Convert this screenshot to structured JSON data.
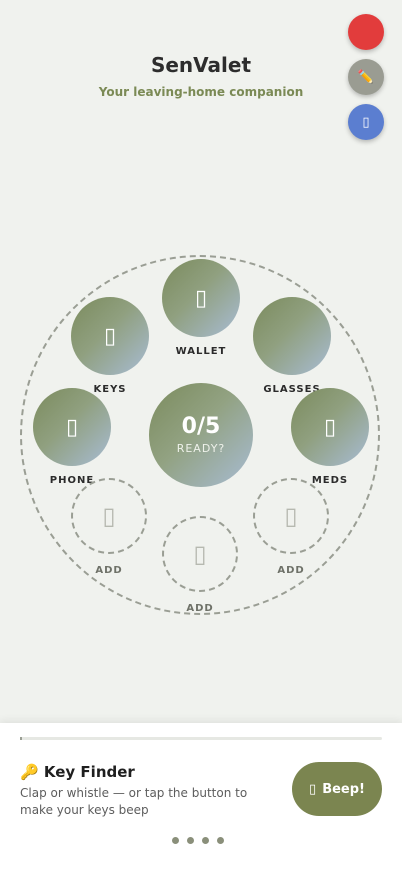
{
  "header": {
    "title": "SenValet",
    "subtitle": "Your leaving-home companion"
  },
  "fabs": [
    {
      "name": "record",
      "color": "#e23c3c",
      "icon": "record-icon",
      "glyph": ""
    },
    {
      "name": "edit",
      "color": "#9a9c92",
      "icon": "pencil-icon",
      "glyph": "✏️"
    },
    {
      "name": "info",
      "color": "#5b7ed0",
      "icon": "info-icon",
      "glyph": "▯"
    }
  ],
  "center": {
    "count": "0/5",
    "status": "READY?"
  },
  "items": {
    "wallet": {
      "label": "WALLET",
      "icon": "wallet-icon",
      "glyph": "▯"
    },
    "keys": {
      "label": "KEYS",
      "icon": "keys-icon",
      "glyph": "▯"
    },
    "glasses": {
      "label": "GLASSES",
      "icon": "glasses-icon",
      "glyph": ""
    },
    "phone": {
      "label": "PHONE",
      "icon": "phone-icon",
      "glyph": "▯"
    },
    "meds": {
      "label": "MEDS",
      "icon": "meds-icon",
      "glyph": "▯"
    }
  },
  "add_slots": {
    "left": {
      "label": "ADD",
      "glyph": "▯"
    },
    "bottom": {
      "label": "ADD",
      "glyph": "▯"
    },
    "right": {
      "label": "ADD",
      "glyph": "▯"
    }
  },
  "key_finder": {
    "title": "🔑 Key Finder",
    "description": "Clap or whistle — or tap the button to make your keys beep",
    "button_icon": "▯",
    "button_label": "Beep!"
  },
  "pager": {
    "dots": 4
  },
  "colors": {
    "accent": "#7b8550",
    "subtitle": "#7b8a55",
    "background": "#f0f2ee"
  }
}
